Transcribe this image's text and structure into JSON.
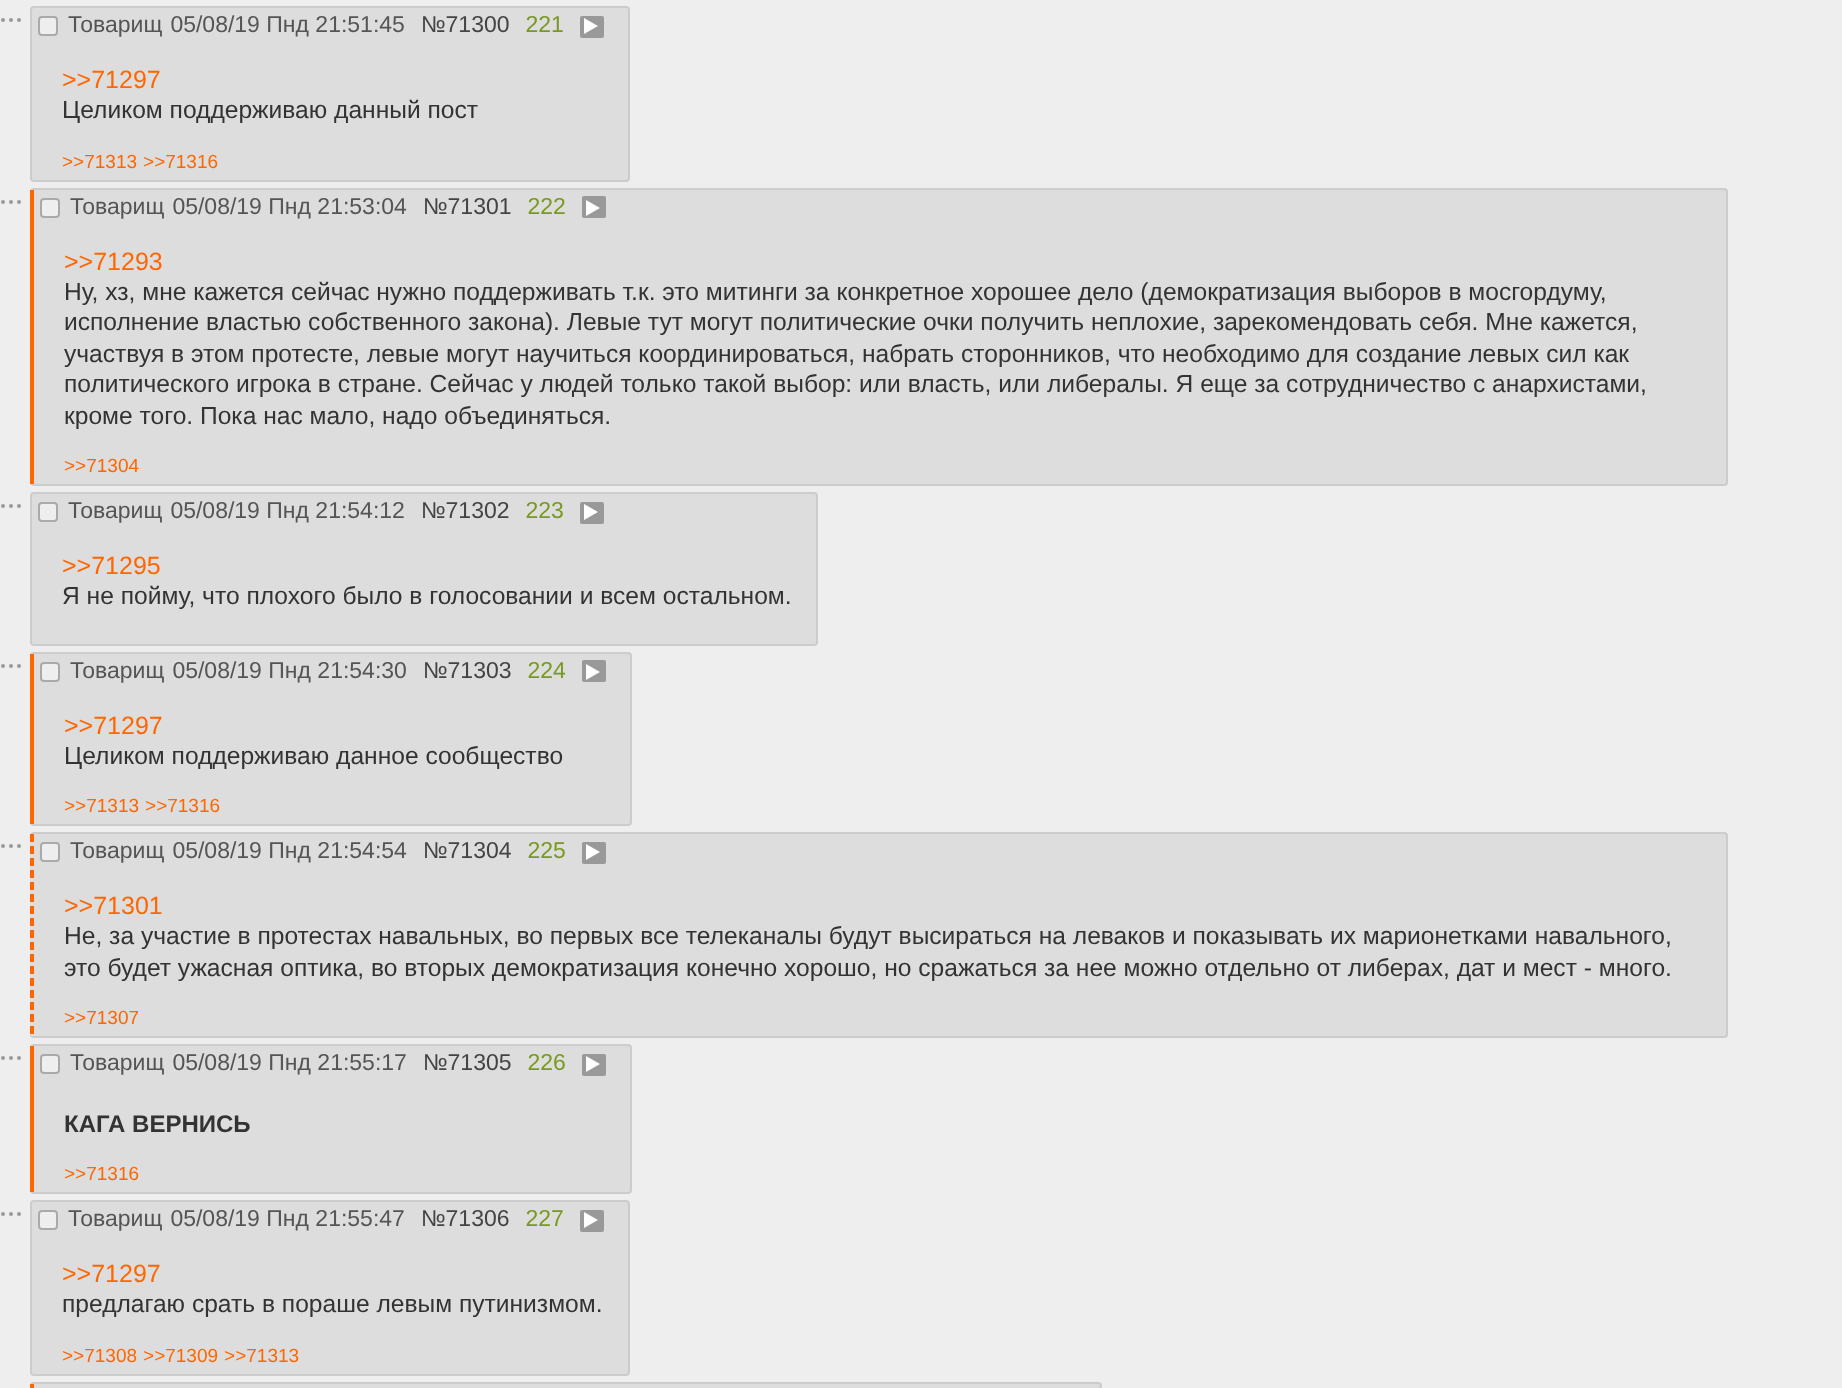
{
  "posts": [
    {
      "checked": false,
      "name": "Товарищ",
      "date": "05/08/19 Пнд 21:51:45",
      "number": "№71300",
      "count": "221",
      "highlighted": false,
      "dashed": false,
      "quote": ">>71297",
      "body": "Целиком поддерживаю данный пост",
      "bold": false,
      "replies": [
        ">>71313",
        ">>71316"
      ]
    },
    {
      "checked": false,
      "name": "Товарищ",
      "date": "05/08/19 Пнд 21:53:04",
      "number": "№71301",
      "count": "222",
      "highlighted": true,
      "dashed": false,
      "quote": ">>71293",
      "body": "Ну, хз, мне кажется сейчас нужно поддерживать т.к. это митинги за конкретное хорошее дело (демократизация выборов в мосгордуму, исполнение властью собственного закона). Левые тут могут политические очки получить неплохие, зарекомендовать себя. Мне кажется, участвуя в этом протесте, левые могут научиться координироваться, набрать сторонников, что необходимо для создание левых сил как политического игрока в стране. Сейчас у людей только такой выбор: или власть, или либералы. Я еще за сотрудничество с анархистами, кроме того. Пока нас мало, надо объединяться.",
      "bold": false,
      "replies": [
        ">>71304"
      ]
    },
    {
      "checked": false,
      "name": "Товарищ",
      "date": "05/08/19 Пнд 21:54:12",
      "number": "№71302",
      "count": "223",
      "highlighted": false,
      "dashed": false,
      "quote": ">>71295",
      "body": "Я не пойму, что плохого было в голосовании и всем остальном.",
      "bold": false
    },
    {
      "checked": false,
      "name": "Товарищ",
      "date": "05/08/19 Пнд 21:54:30",
      "number": "№71303",
      "count": "224",
      "highlighted": true,
      "dashed": false,
      "quote": ">>71297",
      "body": "Целиком поддерживаю данное сообщество",
      "bold": false,
      "replies": [
        ">>71313",
        ">>71316"
      ]
    },
    {
      "checked": false,
      "name": "Товарищ",
      "date": "05/08/19 Пнд 21:54:54",
      "number": "№71304",
      "count": "225",
      "highlighted": true,
      "dashed": true,
      "quote": ">>71301",
      "body": "Не, за участие в протестах навальных, во первых все телеканалы будут высираться на леваков и показывать их марионетками навального, это будет ужасная оптика, во вторых демократизация конечно хорошо, но сражаться за нее можно отдельно от либерах, дат и мест - много.",
      "bold": false,
      "replies": [
        ">>71307"
      ]
    },
    {
      "checked": false,
      "name": "Товарищ",
      "date": "05/08/19 Пнд 21:55:17",
      "number": "№71305",
      "count": "226",
      "highlighted": true,
      "dashed": false,
      "body": "КАГА ВЕРНИСЬ",
      "bold": true,
      "replies": [
        ">>71316"
      ]
    },
    {
      "checked": false,
      "name": "Товарищ",
      "date": "05/08/19 Пнд 21:55:47",
      "number": "№71306",
      "count": "227",
      "highlighted": false,
      "dashed": false,
      "quote": ">>71297",
      "body": "предлагаю срать в пораше левым путинизмом.",
      "bold": false,
      "replies": [
        ">>71308",
        ">>71309",
        ">>71313"
      ]
    },
    {
      "highlighted": true,
      "dashed": false
    }
  ]
}
